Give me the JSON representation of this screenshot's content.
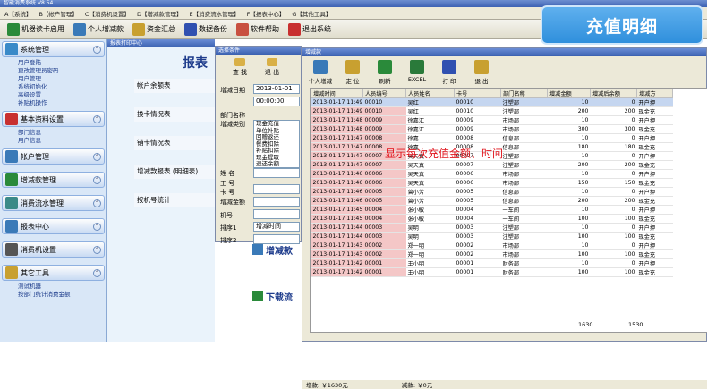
{
  "window": {
    "title": "智能消费系统  V8.54"
  },
  "menu": [
    "A【系统】",
    "B【帐户管理】",
    "C【消费机设置】",
    "D【增减款管理】",
    "E【消费流水管理】",
    "F【报表中心】",
    "G【其他工具】"
  ],
  "toolbar": [
    {
      "label": "机器读卡启用",
      "icon": "card-reader-icon",
      "color": "#2a8a3a"
    },
    {
      "label": "个人增减款",
      "icon": "wallet-icon",
      "color": "#3a7ab8"
    },
    {
      "label": "资金汇总",
      "icon": "money-icon",
      "color": "#c8a030"
    },
    {
      "label": "数据备份",
      "icon": "backup-icon",
      "color": "#3050b0"
    },
    {
      "label": "软件帮助",
      "icon": "help-icon",
      "color": "#c85040"
    },
    {
      "label": "退出系统",
      "icon": "exit-icon",
      "color": "#c83030"
    }
  ],
  "badge": "充值明细",
  "sidebar": {
    "sections": [
      {
        "label": "系统管理",
        "icon": "system-icon",
        "color": "#3a8ac8",
        "items": [
          "用户登陆",
          "更改管理员密码",
          "用户管理",
          "系统初始化",
          "高级设置",
          "补贴机操作"
        ]
      },
      {
        "label": "基本资料设置",
        "icon": "profile-icon",
        "color": "#c83030",
        "items": [
          "部门信息",
          "用户信息"
        ]
      },
      {
        "label": "帐户管理",
        "icon": "account-icon",
        "color": "#3a7ab8",
        "items": []
      },
      {
        "label": "增减款管理",
        "icon": "adjust-icon",
        "color": "#2a8a3a",
        "items": []
      },
      {
        "label": "消费流水管理",
        "icon": "flow-icon",
        "color": "#3a8a88",
        "items": []
      },
      {
        "label": "报表中心",
        "icon": "report-icon",
        "color": "#3a7ab8",
        "items": []
      },
      {
        "label": "消费机设置",
        "icon": "machine-icon",
        "color": "#555555",
        "items": []
      },
      {
        "label": "其它工具",
        "icon": "tools-icon",
        "color": "#c8a030",
        "items": [
          "测试机器",
          "按部门统计消费金额"
        ]
      }
    ]
  },
  "report_window": {
    "title": "报表打印中心",
    "heading": "报表",
    "items": [
      "帐户余额表",
      "换卡情况表",
      "销卡情况表",
      "增减款报表 (明细表)",
      "按机号统计"
    ],
    "lower_items": [
      "增减款",
      "下载流"
    ]
  },
  "condition": {
    "title": "选择条件",
    "buttons": [
      "查 找",
      "退 出"
    ],
    "date_label": "增减日期",
    "date_value": "2013-01-01",
    "time_value": "00:00:00",
    "dept_label": "部门名称",
    "type_label": "增减类别",
    "type_options": [
      "现金充值",
      "单位补贴",
      "回赠返还",
      "餐费扣除",
      "补贴扣除",
      "现金提取",
      "退还余额"
    ],
    "name_label": "姓 名",
    "emp_label": "工 号",
    "card_label": "卡 号",
    "amount_label": "增减金额",
    "machine_label": "机号",
    "sort1_label": "排序1",
    "sort1_value": "增减时间",
    "sort2_label": "排序2"
  },
  "main_window": {
    "title": "增减款",
    "buttons": [
      {
        "label": "个人增减",
        "icon": "person-add-icon",
        "color": "#3a7ab8"
      },
      {
        "label": "定 位",
        "icon": "locate-icon",
        "color": "#c8a030"
      },
      {
        "label": "刷新",
        "icon": "refresh-icon",
        "color": "#2a8a3a"
      },
      {
        "label": "EXCEL",
        "icon": "excel-icon",
        "color": "#2a7a3a"
      },
      {
        "label": "打 印",
        "icon": "print-icon",
        "color": "#3050b0"
      },
      {
        "label": "退 出",
        "icon": "exit-icon",
        "color": "#c8a030"
      }
    ],
    "columns": [
      "增减时间",
      "人员编号",
      "人员姓名",
      "卡号",
      "部门名称",
      "增减金额",
      "增减后余额",
      "增减方"
    ],
    "rows": [
      [
        "2013-01-17 11:49",
        "00010",
        "吴红",
        "00010",
        "注塑部",
        "10",
        "0",
        "开户押"
      ],
      [
        "2013-01-17 11:49",
        "00010",
        "吴红",
        "00010",
        "注塑部",
        "200",
        "200",
        "现金充"
      ],
      [
        "2013-01-17 11:48",
        "00009",
        "徐嘉汇",
        "00009",
        "市场部",
        "10",
        "0",
        "开户押"
      ],
      [
        "2013-01-17 11:48",
        "00009",
        "徐嘉汇",
        "00009",
        "市场部",
        "300",
        "300",
        "现金充"
      ],
      [
        "2013-01-17 11:47",
        "00008",
        "徐嘉",
        "00008",
        "信息部",
        "10",
        "0",
        "开户押"
      ],
      [
        "2013-01-17 11:47",
        "00008",
        "徐嘉",
        "00008",
        "信息部",
        "180",
        "180",
        "现金充"
      ],
      [
        "2013-01-17 11:47",
        "00007",
        "吴天真",
        "00007",
        "注塑部",
        "10",
        "0",
        "开户押"
      ],
      [
        "2013-01-17 11:47",
        "00007",
        "吴天真",
        "00007",
        "注塑部",
        "200",
        "200",
        "现金充"
      ],
      [
        "2013-01-17 11:46",
        "00006",
        "吴天真",
        "00006",
        "市场部",
        "10",
        "0",
        "开户押"
      ],
      [
        "2013-01-17 11:46",
        "00006",
        "吴天真",
        "00006",
        "市场部",
        "150",
        "150",
        "现金充"
      ],
      [
        "2013-01-17 11:46",
        "00005",
        "曾小芳",
        "00005",
        "信息部",
        "10",
        "0",
        "开户押"
      ],
      [
        "2013-01-17 11:46",
        "00005",
        "曾小芳",
        "00005",
        "信息部",
        "200",
        "200",
        "现金充"
      ],
      [
        "2013-01-17 11:45",
        "00004",
        "张小敏",
        "00004",
        "一车间",
        "10",
        "0",
        "开户押"
      ],
      [
        "2013-01-17 11:45",
        "00004",
        "张小敏",
        "00004",
        "一车间",
        "100",
        "100",
        "现金充"
      ],
      [
        "2013-01-17 11:44",
        "00003",
        "吴明",
        "00003",
        "注塑部",
        "10",
        "0",
        "开户押"
      ],
      [
        "2013-01-17 11:44",
        "00003",
        "吴明",
        "00003",
        "注塑部",
        "100",
        "100",
        "现金充"
      ],
      [
        "2013-01-17 11:43",
        "00002",
        "郑一明",
        "00002",
        "市场部",
        "10",
        "0",
        "开户押"
      ],
      [
        "2013-01-17 11:43",
        "00002",
        "郑一明",
        "00002",
        "市场部",
        "100",
        "100",
        "现金充"
      ],
      [
        "2013-01-17 11:42",
        "00001",
        "王小明",
        "00001",
        "财务部",
        "10",
        "0",
        "开户押"
      ],
      [
        "2013-01-17 11:42",
        "00001",
        "王小明",
        "00001",
        "财务部",
        "100",
        "100",
        "现金充"
      ]
    ],
    "total_amount": "1630",
    "total_balance": "1530",
    "status_increase": "增款: ￥1630元",
    "status_decrease": "减款: ￥0元"
  },
  "annotation": "显示每次充值金额、时间"
}
